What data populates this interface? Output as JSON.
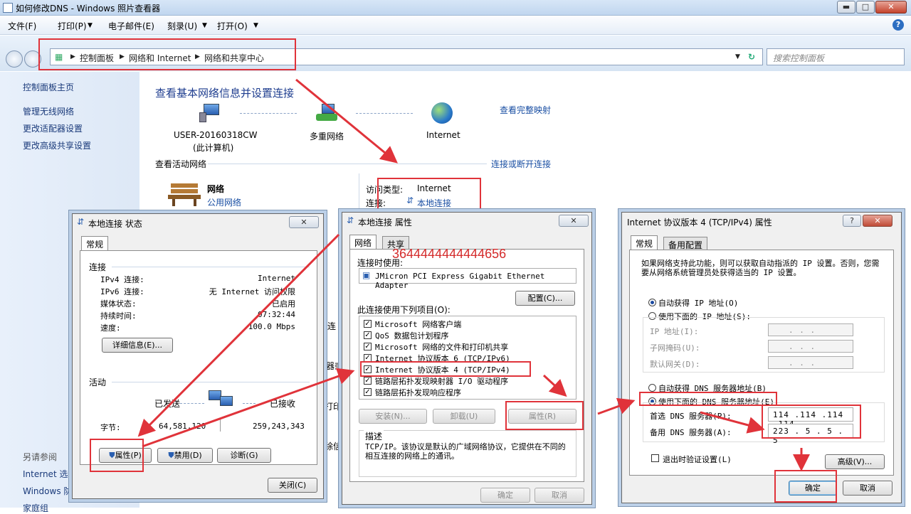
{
  "window": {
    "title": "如何修改DNS - Windows 照片查看器",
    "min": "▬",
    "max": "□",
    "close": "✕"
  },
  "menu": [
    "文件(F)",
    "打印(P)",
    "电子邮件(E)",
    "刻录(U)",
    "打开(O)"
  ],
  "help": "?",
  "breadcrumb": [
    "控制面板",
    "网络和 Internet",
    "网络和共享中心"
  ],
  "search_placeholder": "搜索控制面板",
  "sidebar": {
    "links": [
      "控制面板主页",
      "管理无线网络",
      "更改适配器设置",
      "更改高级共享设置"
    ],
    "see_also": "另请参阅",
    "see_also_links": [
      "Internet 选项",
      "Windows 防",
      "家庭组"
    ]
  },
  "main": {
    "title": "查看基本网络信息并设置连接",
    "full_map": "查看完整映射",
    "computer": "USER-20160318CW",
    "computer_sub": "(此计算机)",
    "network": "多重网络",
    "internet": "Internet",
    "active_header": "查看活动网络",
    "connect_link": "连接或断开连接",
    "net_name": "网络",
    "net_type": "公用网络",
    "access_label": "访问类型:",
    "access_value": "Internet",
    "conn_label": "连接:",
    "conn_value": "本地连接",
    "frag": [
      "连",
      "器或",
      "打印",
      "除信"
    ]
  },
  "status_dialog": {
    "title": "本地连接 状态",
    "tab": "常规",
    "section_conn": "连接",
    "rows": [
      {
        "k": "IPv4 连接:",
        "v": "Internet"
      },
      {
        "k": "IPv6 连接:",
        "v": "无 Internet 访问权限"
      },
      {
        "k": "媒体状态:",
        "v": "已启用"
      },
      {
        "k": "持续时间:",
        "v": "07:32:44"
      },
      {
        "k": "速度:",
        "v": "100.0 Mbps"
      }
    ],
    "details": "详细信息(E)...",
    "section_activity": "活动",
    "sent": "已发送",
    "received": "已接收",
    "bytes_label": "字节:",
    "bytes_sent": "64,581,120",
    "bytes_received": "259,243,343",
    "btn_props": "属性(P)",
    "btn_disable": "禁用(D)",
    "btn_diagnose": "诊断(G)",
    "btn_close": "关闭(C)"
  },
  "props_dialog": {
    "title": "本地连接 属性",
    "tabs": [
      "网络",
      "共享"
    ],
    "overlay": "3644444444444656",
    "connect_using": "连接时使用:",
    "adapter": "JMicron PCI Express Gigabit Ethernet Adapter",
    "configure": "配置(C)...",
    "items_label": "此连接使用下列项目(O):",
    "items": [
      "Microsoft 网络客户端",
      "QoS 数据包计划程序",
      "Microsoft 网络的文件和打印机共享",
      "Internet 协议版本 6 (TCP/IPv6)",
      "Internet 协议版本 4 (TCP/IPv4)",
      "链路层拓扑发现映射器 I/O 驱动程序",
      "链路层拓扑发现响应程序"
    ],
    "install": "安装(N)...",
    "uninstall": "卸载(U)",
    "properties": "属性(R)",
    "desc_label": "描述",
    "desc": "TCP/IP。该协议是默认的广域网络协议，它提供在不同的相互连接的网络上的通讯。",
    "ok": "确定",
    "cancel": "取消"
  },
  "ipv4_dialog": {
    "title": "Internet 协议版本 4 (TCP/IPv4) 属性",
    "tabs": [
      "常规",
      "备用配置"
    ],
    "intro": "如果网络支持此功能，则可以获取自动指派的 IP 设置。否则，您需要从网络系统管理员处获得适当的 IP 设置。",
    "auto_ip": "自动获得 IP 地址(O)",
    "manual_ip": "使用下面的 IP 地址(S):",
    "ip_label": "IP 地址(I):",
    "mask_label": "子网掩码(U):",
    "gw_label": "默认网关(D):",
    "auto_dns": "自动获得 DNS 服务器地址(B)",
    "manual_dns": "使用下面的 DNS 服务器地址(E):",
    "pref_dns_label": "首选 DNS 服务器(P):",
    "pref_dns": "114 .114 .114 .114",
    "alt_dns_label": "备用 DNS 服务器(A):",
    "alt_dns": "223 . 5  . 5  . 5",
    "empty_ip": ".   .   .",
    "validate": "退出时验证设置(L)",
    "advanced": "高级(V)...",
    "ok": "确定",
    "cancel": "取消"
  }
}
